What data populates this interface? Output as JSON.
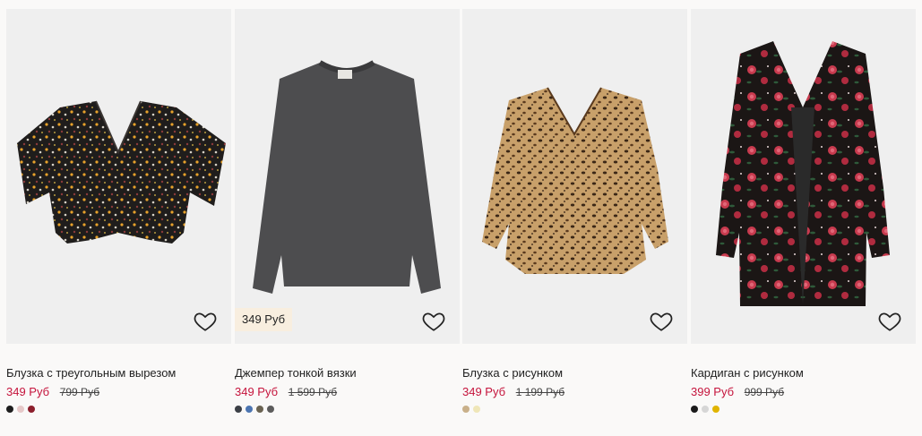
{
  "products": [
    {
      "title": "Блузка с треугольным вырезом",
      "price": "349 Руб",
      "old_price": "799 Руб",
      "badge": "",
      "image_icon": "floral-blouse-image",
      "swatches": [
        "#1d1d1d",
        "#e6c9c9",
        "#8c1f2c"
      ]
    },
    {
      "title": "Джемпер тонкой вязки",
      "price": "349 Руб",
      "old_price": "1 599 Руб",
      "badge": "349 Руб",
      "image_icon": "grey-sweater-image",
      "swatches": [
        "#3b3f46",
        "#4c75b1",
        "#6a6352",
        "#5c5c5c"
      ]
    },
    {
      "title": "Блузка с рисунком",
      "price": "349 Руб",
      "old_price": "1 199 Руб",
      "badge": "",
      "image_icon": "leopard-blouse-image",
      "swatches": [
        "#c9b08a",
        "#efe6b8"
      ]
    },
    {
      "title": "Кардиган с рисунком",
      "price": "399 Руб",
      "old_price": "999 Руб",
      "badge": "",
      "image_icon": "floral-cardigan-image",
      "swatches": [
        "#1a1a1a",
        "#d6d6d6",
        "#e0b400"
      ]
    }
  ],
  "colors": {
    "sale": "#c5143c",
    "badge_bg": "#f8eedf",
    "card_bg": "#efefef",
    "page_bg": "#faf9f8"
  }
}
